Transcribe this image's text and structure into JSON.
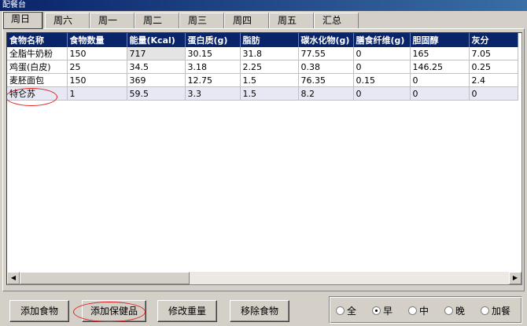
{
  "window": {
    "title": "配餐台"
  },
  "tabs": [
    "周日",
    "周六",
    "周一",
    "周二",
    "周三",
    "周四",
    "周五",
    "汇总"
  ],
  "active_tab": 0,
  "table": {
    "columns": [
      "食物名称",
      "食物数量",
      "能量(Kcal)",
      "蛋白质(g)",
      "脂肪",
      "碳水化物(g)",
      "膳食纤维(g)",
      "胆固醇",
      "灰分"
    ],
    "rows": [
      [
        "全脂牛奶粉",
        "150",
        "717",
        "30.15",
        "31.8",
        "77.55",
        "0",
        "165",
        "7.05"
      ],
      [
        "鸡蛋(白皮)",
        "25",
        "34.5",
        "3.18",
        "2.25",
        "0.38",
        "0",
        "146.25",
        "0.25"
      ],
      [
        "麦胚面包",
        "150",
        "369",
        "12.75",
        "1.5",
        "76.35",
        "0.15",
        "0",
        "2.4"
      ],
      [
        "特仑苏",
        "1",
        "59.5",
        "3.3",
        "1.5",
        "8.2",
        "0",
        "0",
        "0"
      ]
    ]
  },
  "buttons": {
    "add_food": "添加食物",
    "add_health": "添加保健品",
    "modify_weight": "修改重量",
    "remove_food": "移除食物"
  },
  "meal_options": [
    "全",
    "早",
    "中",
    "晚",
    "加餐"
  ],
  "meal_selected": 1,
  "scroll": {
    "left_arrow": "◀",
    "right_arrow": "▶"
  },
  "colors": {
    "header_bg": "#0a246a",
    "annotation": "#d22222"
  }
}
